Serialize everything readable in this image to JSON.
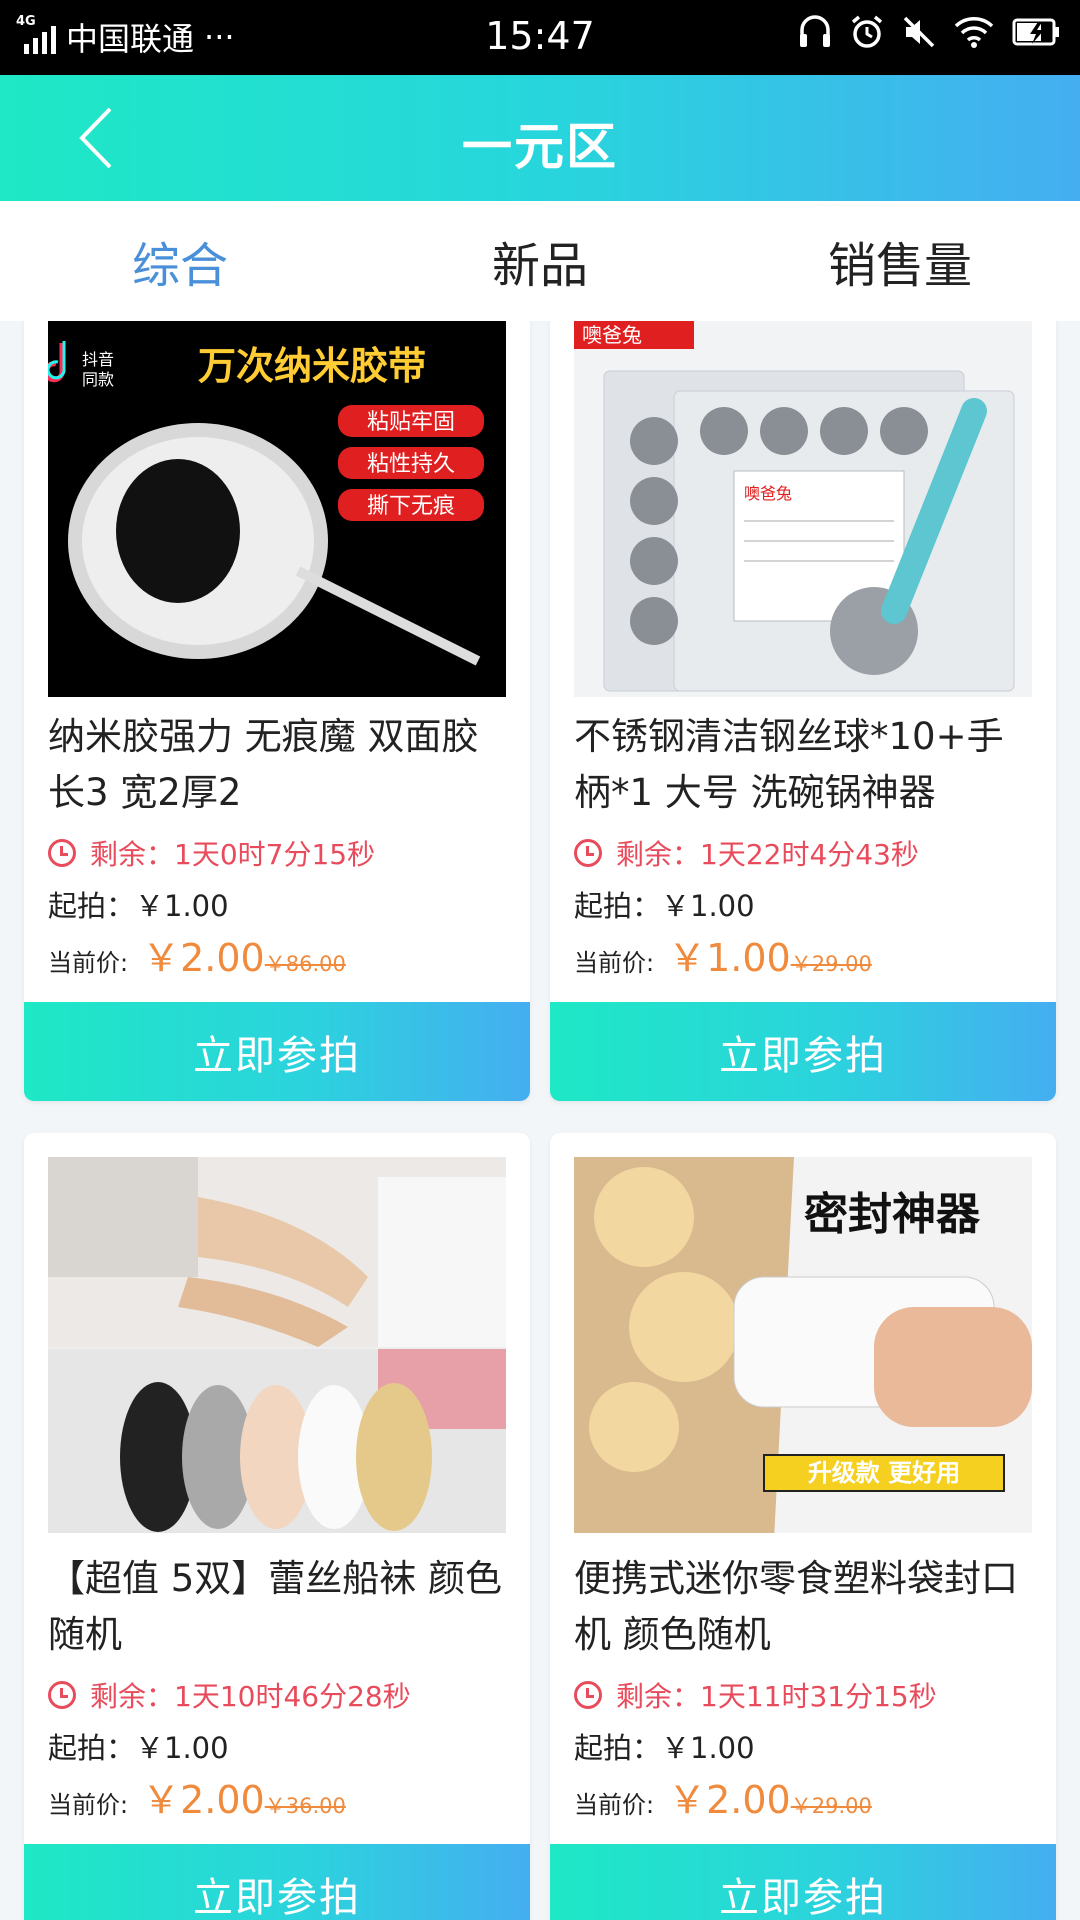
{
  "status": {
    "network": "4G",
    "carrier": "中国联通",
    "more": "···",
    "time": "15:47"
  },
  "header": {
    "title": "一元区"
  },
  "tabs": [
    {
      "label": "综合",
      "active": true
    },
    {
      "label": "新品",
      "active": false
    },
    {
      "label": "销售量",
      "active": false
    }
  ],
  "products": [
    {
      "name": "纳米胶强力 无痕魔 双面胶 长3 宽2厚2",
      "remaining": "剩余：1天0时7分15秒",
      "start": "起拍：￥1.00",
      "current_label": "当前价:",
      "current_price": "￥2.00",
      "original_price": "￥86.00",
      "button": "立即参拍",
      "image": {
        "badge_a": "抖音",
        "badge_b": "同款",
        "headline": "万次纳米胶带",
        "tags": [
          "粘贴牢固",
          "粘性持久",
          "撕下无痕"
        ]
      }
    },
    {
      "name": "不锈钢清洁钢丝球*10+手柄*1 大号 洗碗锅神器",
      "remaining": "剩余：1天22时4分43秒",
      "start": "起拍：￥1.00",
      "current_label": "当前价:",
      "current_price": "￥1.00",
      "original_price": "￥29.00",
      "button": "立即参拍",
      "image": {
        "brand": "噢爸兔",
        "brand2": "噢爸兔"
      }
    },
    {
      "name": "【超值 5双】蕾丝船袜 颜色随机",
      "remaining": "剩余：1天10时46分28秒",
      "start": "起拍：￥1.00",
      "current_label": "当前价:",
      "current_price": "￥2.00",
      "original_price": "￥36.00",
      "button": "立即参拍",
      "image": {}
    },
    {
      "name": "便携式迷你零食塑料袋封口机 颜色随机",
      "remaining": "剩余：1天11时31分15秒",
      "start": "起拍：￥1.00",
      "current_label": "当前价:",
      "current_price": "￥2.00",
      "original_price": "￥29.00",
      "button": "立即参拍",
      "image": {
        "headline": "密封神器",
        "banner": "升级款 更好用"
      }
    }
  ],
  "colors": {
    "accent_blue": "#4a90d9",
    "countdown_red": "#e84c5c",
    "price_orange": "#f08a3c",
    "gradient_start": "#1ee8c5",
    "gradient_end": "#45aef1"
  }
}
